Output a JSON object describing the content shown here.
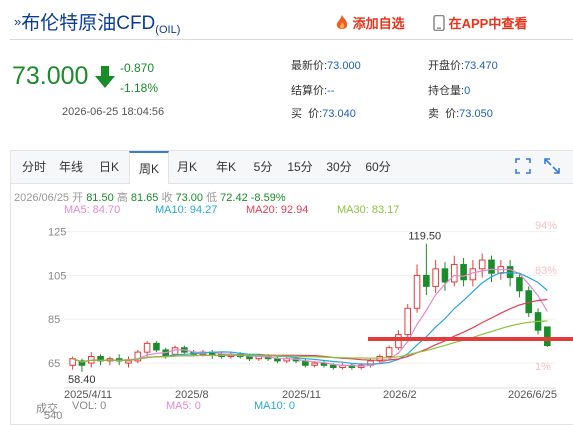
{
  "header": {
    "title": "布伦特原油CFD",
    "code": "(OIL)",
    "add_watch": "添加自选",
    "view_app": "在APP中查看"
  },
  "quote": {
    "price": "73.000",
    "change": "-0.870",
    "change_pct": "-1.18%",
    "time": "2026-06-25 18:04:56",
    "fields": {
      "latest_label": "最新价:",
      "latest": "73.000",
      "open_label": "开盘价:",
      "open": "73.470",
      "settle_label": "结算价:",
      "settle": "--",
      "hold_label": "持仓量:",
      "hold": "0",
      "buy_label": "买  价:",
      "buy": "73.040",
      "sell_label": "卖  价:",
      "sell": "73.050"
    }
  },
  "tabs": [
    "分时",
    "年线",
    "日K",
    "周K",
    "月K",
    "年K",
    "5分",
    "15分",
    "30分",
    "60分"
  ],
  "active_tab": "周K",
  "ohlc": {
    "date": "2026/06/25",
    "open_label": "开",
    "open": "81.50",
    "high_label": "高",
    "high": "81.65",
    "close_label": "收",
    "close": "73.00",
    "low_label": "低",
    "low": "72.42",
    "pct": "-8.59%"
  },
  "ma": [
    {
      "label": "MA5: 84.70",
      "color": "#e38ad0"
    },
    {
      "label": "MA10: 94.27",
      "color": "#29a8d6"
    },
    {
      "label": "MA20: 92.94",
      "color": "#e0405a"
    },
    {
      "label": "MA30: 83.17",
      "color": "#8cc23a"
    }
  ],
  "volume": {
    "label": "成交",
    "vol": "VOL: 0",
    "ma5": "MA5: 0",
    "ma10": "MA10: 0",
    "axis_top": "540"
  },
  "colors": {
    "up": "#e43c3c",
    "down": "#1a8c2a",
    "accent": "#3b7bd5"
  },
  "chart_data": {
    "type": "candlestick",
    "y_ticks": [
      "125",
      "105",
      "85",
      "65"
    ],
    "pct_ticks": [
      "94%",
      "83%",
      "1%"
    ],
    "x_ticks": [
      "2025/4/11",
      "2025/8",
      "2025/11",
      "2026/2",
      "2026/6/25"
    ],
    "high_label": "119.50",
    "low_label": "58.40",
    "ylim": [
      55,
      128
    ],
    "candles": [
      [
        64,
        67,
        62,
        68
      ],
      [
        66,
        64,
        61,
        67
      ],
      [
        65,
        68,
        63,
        70
      ],
      [
        68,
        66,
        64,
        69
      ],
      [
        66,
        67,
        64,
        68
      ],
      [
        67,
        66,
        64,
        69
      ],
      [
        65,
        66,
        63,
        68
      ],
      [
        66,
        70,
        65,
        71
      ],
      [
        70,
        74,
        68,
        75
      ],
      [
        74,
        71,
        70,
        75
      ],
      [
        71,
        68,
        67,
        72
      ],
      [
        69,
        72,
        68,
        73
      ],
      [
        72,
        70,
        69,
        73
      ],
      [
        70,
        69,
        68,
        71
      ],
      [
        69,
        70,
        68,
        71
      ],
      [
        70,
        69,
        67,
        71
      ],
      [
        69,
        68,
        67,
        70
      ],
      [
        68,
        69,
        67,
        70
      ],
      [
        69,
        68,
        67,
        70
      ],
      [
        68,
        67,
        66,
        69
      ],
      [
        67,
        68,
        66,
        69
      ],
      [
        68,
        67,
        66,
        69
      ],
      [
        67,
        66,
        65,
        68
      ],
      [
        66,
        67,
        65,
        68
      ],
      [
        67,
        66,
        65,
        68
      ],
      [
        66,
        64,
        63,
        67
      ],
      [
        64,
        65,
        63,
        66
      ],
      [
        65,
        64,
        63,
        66
      ],
      [
        64,
        63,
        62,
        65
      ],
      [
        63,
        64,
        62,
        65
      ],
      [
        64,
        63,
        62,
        65
      ],
      [
        63,
        64,
        62,
        65
      ],
      [
        64,
        66,
        63,
        67
      ],
      [
        66,
        68,
        65,
        69
      ],
      [
        68,
        72,
        67,
        73
      ],
      [
        72,
        78,
        71,
        80
      ],
      [
        78,
        90,
        76,
        92
      ],
      [
        90,
        105,
        88,
        110
      ],
      [
        105,
        100,
        96,
        119.5
      ],
      [
        100,
        108,
        97,
        112
      ],
      [
        108,
        102,
        98,
        111
      ],
      [
        102,
        110,
        100,
        114
      ],
      [
        110,
        103,
        100,
        113
      ],
      [
        103,
        108,
        100,
        112
      ],
      [
        108,
        112,
        104,
        115
      ],
      [
        112,
        106,
        102,
        114
      ],
      [
        106,
        109,
        103,
        112
      ],
      [
        109,
        104,
        100,
        112
      ],
      [
        104,
        98,
        95,
        106
      ],
      [
        98,
        88,
        86,
        100
      ],
      [
        88,
        80,
        78,
        90
      ],
      [
        81.5,
        73,
        72.42,
        81.65
      ]
    ]
  }
}
